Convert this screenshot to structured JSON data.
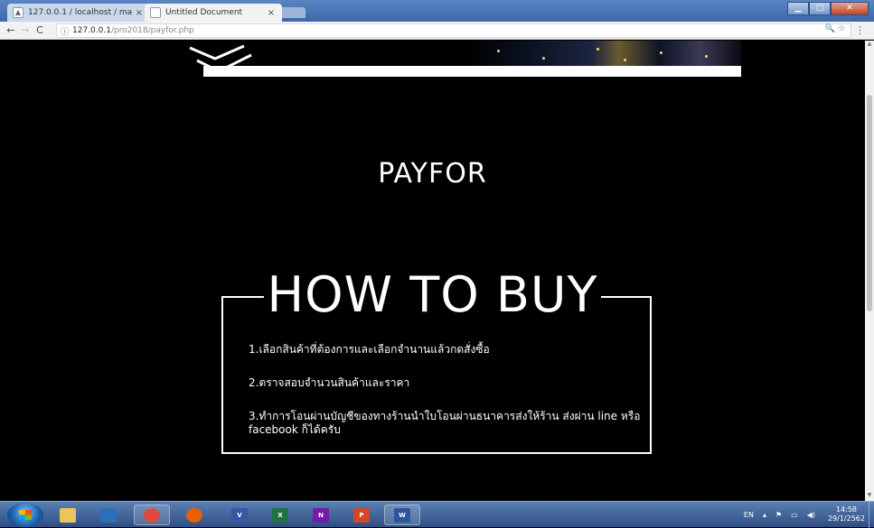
{
  "browser": {
    "tabs": [
      {
        "title": "127.0.0.1 / localhost / ma",
        "icon": "phpmyadmin-icon"
      },
      {
        "title": "Untitled Document",
        "icon": "document-icon"
      }
    ],
    "close_glyph": "×",
    "address": {
      "host": "127.0.0.1",
      "path": "/pro2018/payfor.php",
      "info_glyph": "ⓘ"
    },
    "nav": {
      "back": "←",
      "forward": "→",
      "reload": "C"
    },
    "right_icons": "🔍 ☆",
    "menu_glyph": "⋮",
    "window_buttons": {
      "min": "▁",
      "max": "□",
      "close": "✕"
    }
  },
  "page": {
    "heading": "PAYFOR",
    "section_title": "HOW TO BUY",
    "steps": [
      "1.เลือกสินค้าที่ต้องการและเลือกจำนานแล้วกดสั่งซื้อ",
      "2.ตราจสอบจำนวนสินค้าและราคา",
      "3.ทำการโอนผ่านบัญชีของทางร้านนำใบโอนผ่านธนาคารส่งให้ร้าน ส่งผ่าน line หรือ facebook ก็ได้ครับ"
    ]
  },
  "taskbar": {
    "apps": [
      {
        "name": "explorer",
        "label": "",
        "color": "#e8c65a"
      },
      {
        "name": "media-player",
        "label": "",
        "color": "#2d6fb8"
      },
      {
        "name": "chrome",
        "label": "",
        "color": "#dd4b3e"
      },
      {
        "name": "firefox",
        "label": "",
        "color": "#e66000"
      },
      {
        "name": "visio",
        "label": "V",
        "color": "#3955a3"
      },
      {
        "name": "excel",
        "label": "X",
        "color": "#1f7244"
      },
      {
        "name": "onenote",
        "label": "N",
        "color": "#7719aa"
      },
      {
        "name": "powerpoint",
        "label": "P",
        "color": "#d24726"
      },
      {
        "name": "word",
        "label": "W",
        "color": "#2b579a"
      }
    ],
    "lang": "EN",
    "tray_up": "▴",
    "flag_glyph": "⚑",
    "network_glyph": "▭",
    "volume_glyph": "◀)",
    "time": "14:58",
    "date": "29/1/2562"
  }
}
